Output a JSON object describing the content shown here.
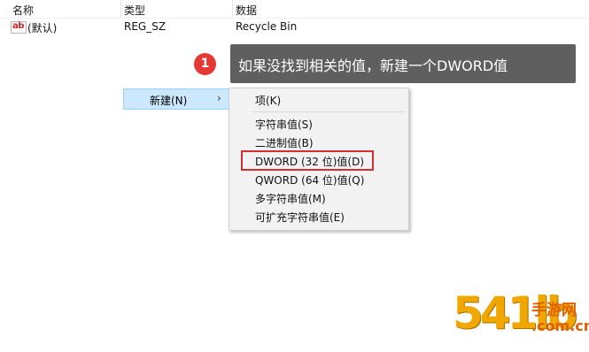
{
  "columns": {
    "name": "名称",
    "type": "类型",
    "data": "数据"
  },
  "row": {
    "icon": "ab-string-value-icon",
    "icon_text": "ab",
    "name": "(默认)",
    "type": "REG_SZ",
    "data": "Recycle Bin"
  },
  "callout": {
    "step": "1",
    "text": "如果没找到相关的值，新建一个DWORD值"
  },
  "context_menu": {
    "new_label": "新建(N)",
    "arrow": "›"
  },
  "submenu": {
    "items": [
      "项(K)",
      "字符串值(S)",
      "二进制值(B)",
      "DWORD (32 位)值(D)",
      "QWORD (64 位)值(Q)",
      "多字符串值(M)",
      "可扩充字符串值(E)"
    ],
    "highlighted_index": 3
  },
  "watermark": {
    "big": "541lb",
    "cn": "手游网",
    "domain": ".com.cn"
  },
  "colors": {
    "callout_bg": "#5f5f5f",
    "badge": "#e53935",
    "menu_hover": "#cce8ff",
    "highlight_border": "#d32f2f",
    "watermark": "#f0a800"
  }
}
